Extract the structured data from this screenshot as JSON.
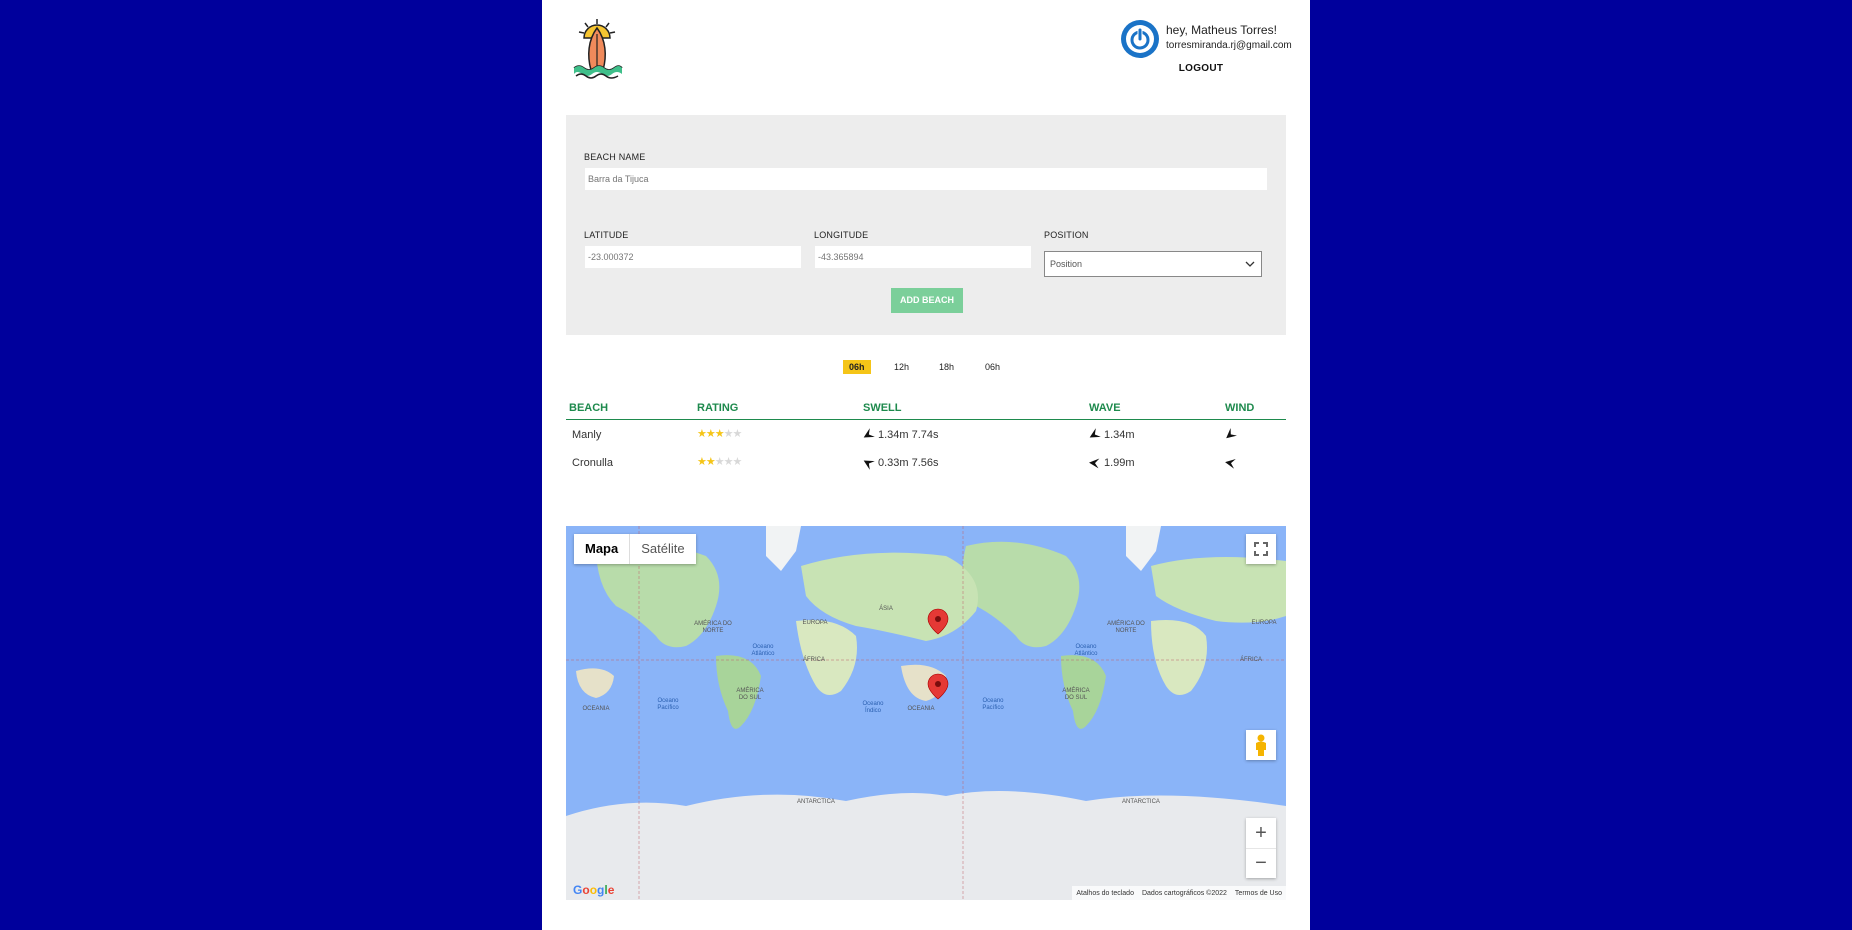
{
  "header": {
    "greeting": "hey, Matheus Torres!",
    "email": "torresmiranda.rj@gmail.com",
    "logout_label": "LOGOUT"
  },
  "form": {
    "beach_name_label": "BEACH NAME",
    "beach_name_placeholder": "Barra da Tijuca",
    "latitude_label": "LATITUDE",
    "latitude_placeholder": "-23.000372",
    "longitude_label": "LONGITUDE",
    "longitude_placeholder": "-43.365894",
    "position_label": "POSITION",
    "position_selected": "Position",
    "add_button": "ADD BEACH"
  },
  "time_tabs": [
    {
      "label": "06h",
      "active": true
    },
    {
      "label": "12h",
      "active": false
    },
    {
      "label": "18h",
      "active": false
    },
    {
      "label": "06h",
      "active": false
    }
  ],
  "table": {
    "headers": [
      "BEACH",
      "RATING",
      "SWELL",
      "WAVE",
      "WIND"
    ],
    "rows": [
      {
        "beach": "Manly",
        "rating": 3,
        "swell": "1.34m 7.74s",
        "wave": "1.34m"
      },
      {
        "beach": "Cronulla",
        "rating": 2,
        "swell": "0.33m 7.56s",
        "wave": "1.99m"
      }
    ]
  },
  "map": {
    "tabs": [
      "Mapa",
      "Satélite"
    ],
    "continents": [
      "AMÉRICA DO NORTE",
      "EUROPA",
      "ÁSIA",
      "ÁFRICA",
      "AMÉRICA DO SUL",
      "OCEANIA",
      "ANTARCTICA"
    ],
    "oceans": [
      "Oceano Atlântico",
      "Oceano Pacífico",
      "Oceano Índico"
    ],
    "logo": "Google",
    "attribution": [
      "Atalhos do teclado",
      "Dados cartográficos ©2022",
      "Termos de Uso"
    ],
    "zoom_in": "+",
    "zoom_out": "−"
  },
  "colors": {
    "background": "#00009c",
    "accent_green": "#1e8a4d",
    "active_tab": "#f5c518",
    "add_button": "#7bcf9a"
  }
}
